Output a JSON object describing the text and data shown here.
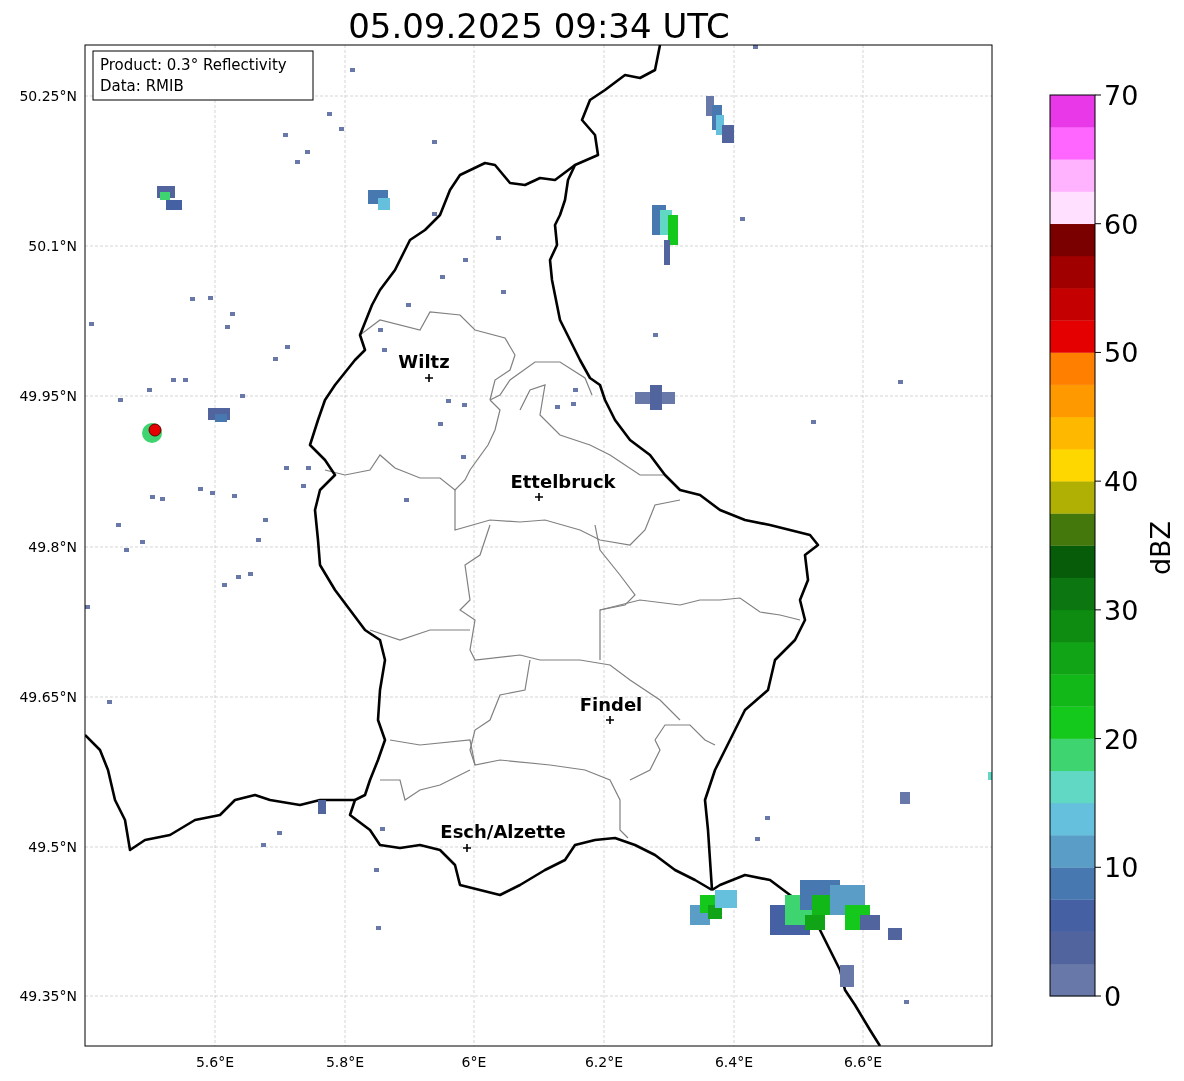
{
  "title": "05.09.2025 09:34 UTC",
  "info_box": [
    "Product: 0.3° Reflectivity",
    "Data: RMIB"
  ],
  "lat_ticks": [
    "50.25°N",
    "50.1°N",
    "49.95°N",
    "49.8°N",
    "49.65°N",
    "49.5°N",
    "49.35°N"
  ],
  "lon_ticks": [
    "5.6°E",
    "5.8°E",
    "6°E",
    "6.2°E",
    "6.4°E",
    "6.6°E"
  ],
  "cities": [
    {
      "name": "Wiltz"
    },
    {
      "name": "Ettelbruck"
    },
    {
      "name": "Findel"
    },
    {
      "name": "Esch/Alzette"
    }
  ],
  "colorbar": {
    "label": "dBZ",
    "ticks": [
      "70",
      "60",
      "50",
      "40",
      "30",
      "20",
      "10",
      "0"
    ],
    "bins": [
      {
        "color": "#6878a8"
      },
      {
        "color": "#52649e"
      },
      {
        "color": "#4660a4"
      },
      {
        "color": "#4878b0"
      },
      {
        "color": "#5a9ec8"
      },
      {
        "color": "#64c0dc"
      },
      {
        "color": "#60d8c4"
      },
      {
        "color": "#3ed470"
      },
      {
        "color": "#14c81c"
      },
      {
        "color": "#12b818"
      },
      {
        "color": "#10a416"
      },
      {
        "color": "#0e8c12"
      },
      {
        "color": "#0c7610"
      },
      {
        "color": "#075c0a"
      },
      {
        "color": "#44780c"
      },
      {
        "color": "#b0b004"
      },
      {
        "color": "#ffd700"
      },
      {
        "color": "#ffb800"
      },
      {
        "color": "#ff9900"
      },
      {
        "color": "#ff7f00"
      },
      {
        "color": "#e40000"
      },
      {
        "color": "#c40000"
      },
      {
        "color": "#a00000"
      },
      {
        "color": "#7a0000"
      },
      {
        "color": "#ffe0ff"
      },
      {
        "color": "#ffb3ff"
      },
      {
        "color": "#ff66ff"
      },
      {
        "color": "#e838e8"
      }
    ]
  }
}
